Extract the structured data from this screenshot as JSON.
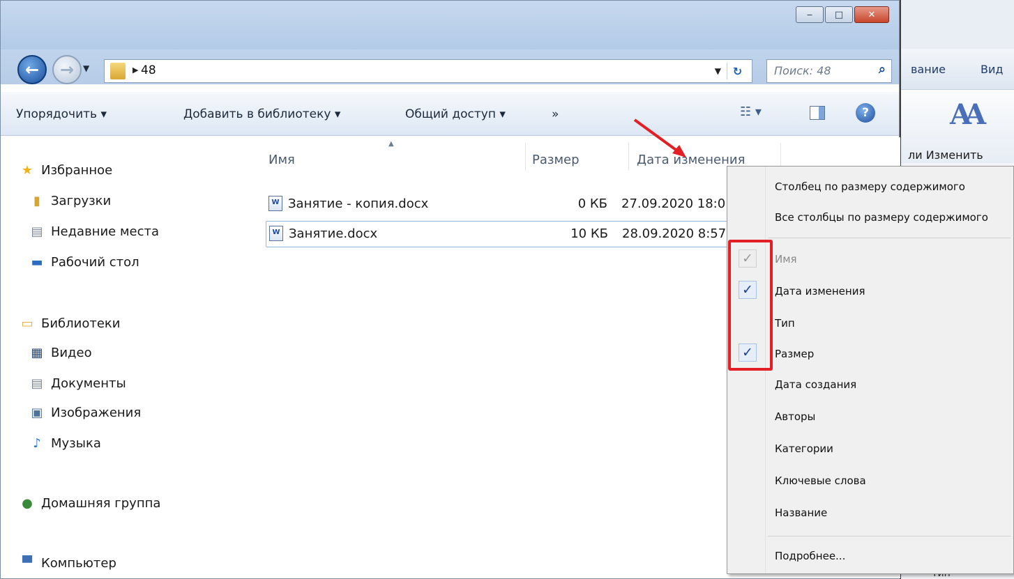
{
  "background_app": {
    "tab_partial_1": "вание",
    "tab_partial_2": "Вид",
    "group_label": "ли  Изменить",
    "bottom_text": "Тип"
  },
  "window": {
    "caption": {
      "minimize": "‒",
      "maximize": "□",
      "close": "✕"
    }
  },
  "address": {
    "path": "48",
    "search_placeholder": "Поиск: 48"
  },
  "toolbar": {
    "organize": "Упорядочить ▾",
    "add_to_library": "Добавить в библиотеку ▾",
    "share": "Общий доступ ▾",
    "more": "»"
  },
  "nav": {
    "favorites": "Избранное",
    "downloads": "Загрузки",
    "recent": "Недавние места",
    "desktop": "Рабочий стол",
    "libraries": "Библиотеки",
    "video": "Видео",
    "documents": "Документы",
    "images": "Изображения",
    "music": "Музыка",
    "homegroup": "Домашняя группа",
    "computer": "Компьютер"
  },
  "columns": {
    "name": "Имя",
    "size": "Размер",
    "date": "Дата изменения"
  },
  "files": [
    {
      "name": "Занятие - копия.docx",
      "size": "0 КБ",
      "date": "27.09.2020 18:0"
    },
    {
      "name": "Занятие.docx",
      "size": "10 КБ",
      "date": "28.09.2020 8:57"
    }
  ],
  "context_menu": {
    "fit_column": "Столбец по размеру содержимого",
    "fit_all": "Все столбцы по размеру содержимого",
    "items": [
      {
        "label": "Имя",
        "checked": true,
        "disabled": true
      },
      {
        "label": "Дата изменения",
        "checked": true
      },
      {
        "label": "Тип",
        "checked": false
      },
      {
        "label": "Размер",
        "checked": true
      },
      {
        "label": "Дата создания",
        "checked": false
      },
      {
        "label": "Авторы",
        "checked": false
      },
      {
        "label": "Категории",
        "checked": false
      },
      {
        "label": "Ключевые слова",
        "checked": false
      },
      {
        "label": "Название",
        "checked": false
      }
    ],
    "more": "Подробнее..."
  },
  "colors": {
    "highlight": "#e31e24",
    "check": "#1a3e9b"
  }
}
